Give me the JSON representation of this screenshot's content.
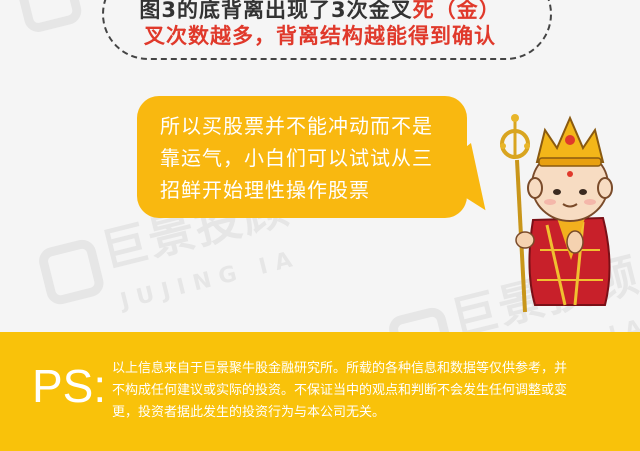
{
  "top_box": {
    "line1_prefix": "图3的底背离出现了3次金叉",
    "line1_red": "死（金）",
    "line2": "叉次数越多，背离结构越能得到确认"
  },
  "bubble": {
    "line1": "所以买股票并不能冲动而不是",
    "line2": "靠运气，小白们可以试试从三",
    "line3": "招鲜开始理性操作股票"
  },
  "watermark": {
    "cn": "巨景投顾",
    "en": "JUJING IA"
  },
  "footer": {
    "ps_label": "PS:",
    "line1": "以上信息来自于巨景聚牛股金融研究所。所载的各种信息和数据等仅供参考，并",
    "line2": "不构成任何建议或实际的投资。不保证当中的观点和判断不会发生任何调整或变",
    "line3": "更，投资者据此发生的投资行为与本公司无关。"
  },
  "colors": {
    "accent_yellow": "#f9b810",
    "band_yellow": "#f9c20a",
    "highlight_red": "#e0392b",
    "background": "#f5f5f5"
  }
}
